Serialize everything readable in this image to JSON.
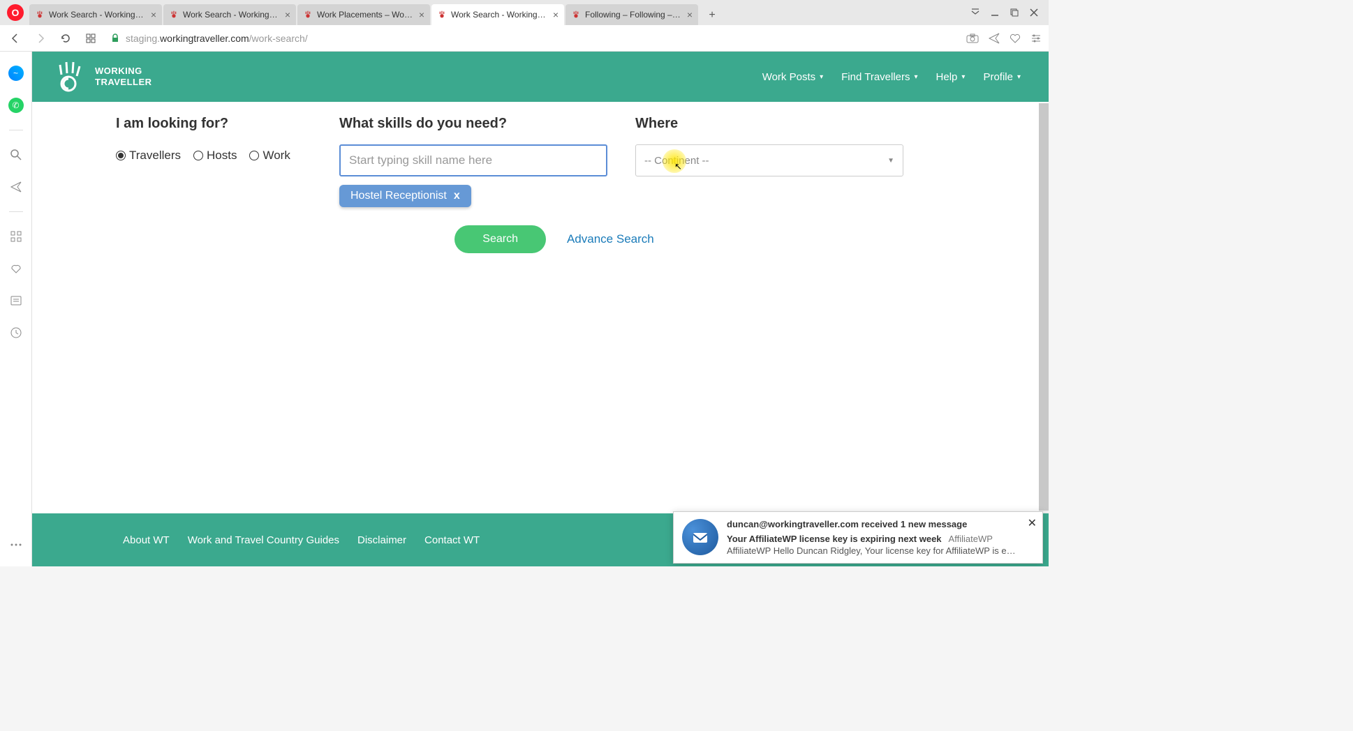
{
  "browser": {
    "tabs": [
      {
        "title": "Work Search - Working Tra",
        "active": false
      },
      {
        "title": "Work Search - Working Tra",
        "active": false
      },
      {
        "title": "Work Placements – Work P",
        "active": false
      },
      {
        "title": "Work Search - Working Tra",
        "active": true
      },
      {
        "title": "Following – Following – Jo",
        "active": false
      }
    ],
    "url_prefix": "staging.",
    "url_domain": "workingtraveller.com",
    "url_path": "/work-search/"
  },
  "site": {
    "logo_line1": "WORKING",
    "logo_line2": "TRAVELLER",
    "nav": [
      {
        "label": "Work Posts"
      },
      {
        "label": "Find Travellers"
      },
      {
        "label": "Help"
      },
      {
        "label": "Profile"
      }
    ]
  },
  "form": {
    "looking_label": "I am looking for?",
    "radios": [
      {
        "label": "Travellers",
        "checked": true
      },
      {
        "label": "Hosts",
        "checked": false
      },
      {
        "label": "Work",
        "checked": false
      }
    ],
    "skills_label": "What skills do you need?",
    "skills_placeholder": "Start typing skill name here",
    "skill_tag": "Hostel Receptionist",
    "skill_tag_x": "x",
    "where_label": "Where",
    "where_value": "-- Continent --",
    "search_btn": "Search",
    "advance_link": "Advance Search"
  },
  "footer": {
    "links": [
      "About WT",
      "Work and Travel Country Guides",
      "Disclaimer",
      "Contact WT"
    ]
  },
  "toast": {
    "title": "duncan@workingtraveller.com received 1 new message",
    "subject": "Your AffiliateWP license key is expiring next week",
    "app": "AffiliateWP",
    "message": "AffiliateWP Hello Duncan Ridgley, Your license key for AffiliateWP is expiring n..."
  }
}
